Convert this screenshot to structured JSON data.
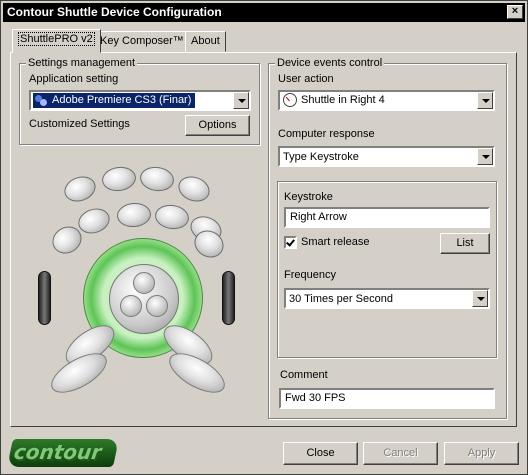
{
  "window": {
    "title": "Contour Shuttle Device Configuration",
    "close_glyph": "×"
  },
  "tabs": [
    {
      "label": "ShuttlePRO v2",
      "active": true
    },
    {
      "label": "Key Composer™",
      "active": false
    },
    {
      "label": "About",
      "active": false
    }
  ],
  "settings": {
    "group_label": "Settings management",
    "app_setting_label": "Application setting",
    "app_setting_value": "Adobe Premiere CS3 (Finar)",
    "app_icon": "premiere-icon",
    "customized_label": "Customized Settings",
    "options_button": "Options"
  },
  "device_events": {
    "group_label": "Device events control",
    "user_action_label": "User action",
    "user_action_value": "Shuttle in Right 4",
    "user_action_icon": "shuttle-dial-icon",
    "computer_response_label": "Computer response",
    "computer_response_value": "Type Keystroke",
    "keystroke_label": "Keystroke",
    "keystroke_value": "Right Arrow",
    "smart_release_label": "Smart release",
    "smart_release_checked": true,
    "list_button": "List",
    "frequency_label": "Frequency",
    "frequency_value": "30 Times per Second",
    "comment_label": "Comment",
    "comment_value": "Fwd 30 FPS"
  },
  "footer": {
    "logo_text": "contour",
    "close_button": "Close",
    "cancel_button": "Cancel",
    "apply_button": "Apply"
  },
  "colors": {
    "selection": "#0a246a",
    "jog_ring": "#5ec457",
    "face": "#d4d0c8"
  }
}
